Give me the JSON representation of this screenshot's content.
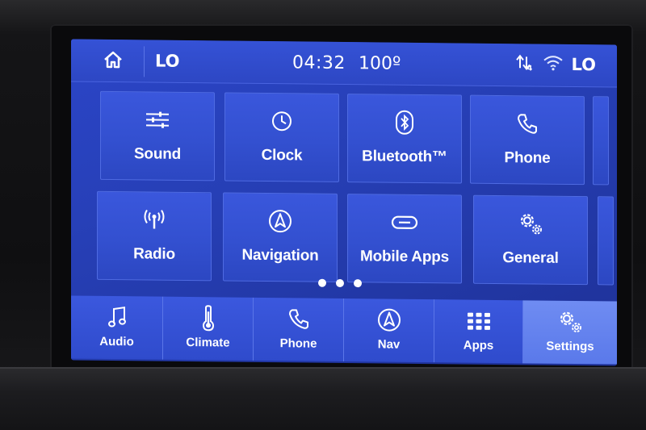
{
  "status_bar": {
    "left_temp": "LO",
    "time": "04:32",
    "outside_temp": "100º",
    "right_temp": "LO"
  },
  "tiles": [
    {
      "label": "Sound",
      "icon": "sliders-icon"
    },
    {
      "label": "Clock",
      "icon": "clock-icon"
    },
    {
      "label": "Bluetooth™",
      "icon": "bluetooth-icon"
    },
    {
      "label": "Phone",
      "icon": "phone-icon"
    },
    {
      "label": "Radio",
      "icon": "antenna-icon"
    },
    {
      "label": "Navigation",
      "icon": "navigation-icon"
    },
    {
      "label": "Mobile Apps",
      "icon": "link-icon"
    },
    {
      "label": "General",
      "icon": "gears-icon"
    }
  ],
  "page_indicator": {
    "pages": 3,
    "current": 1
  },
  "nav": [
    {
      "label": "Audio",
      "icon": "music-note-icon"
    },
    {
      "label": "Climate",
      "icon": "thermometer-icon"
    },
    {
      "label": "Phone",
      "icon": "phone-icon"
    },
    {
      "label": "Nav",
      "icon": "navigation-icon"
    },
    {
      "label": "Apps",
      "icon": "apps-grid-icon"
    },
    {
      "label": "Settings",
      "icon": "gears-icon",
      "active": true
    }
  ],
  "colors": {
    "screen_blue": "#2a44c4",
    "tile_blue": "#3552d6",
    "active_tab": "#6f8cf2",
    "text": "#ffffff"
  }
}
